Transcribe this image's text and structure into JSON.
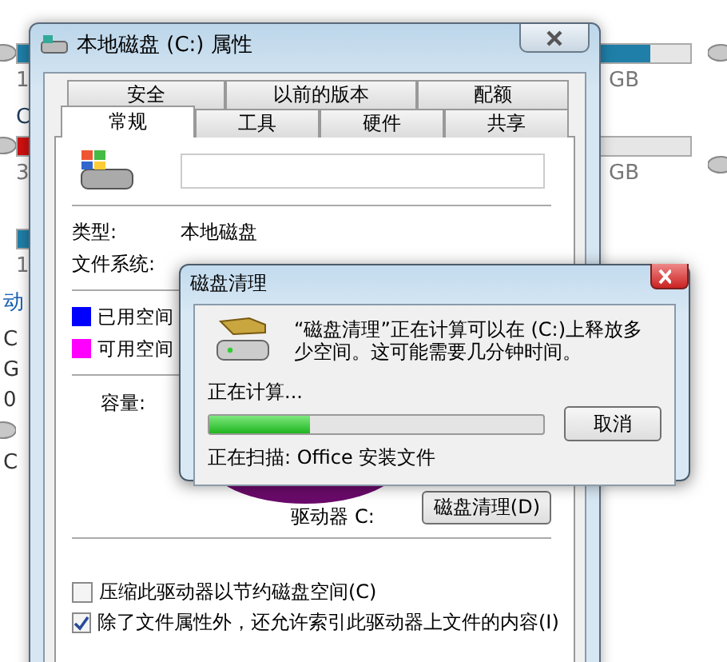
{
  "explorer": {
    "left_tiles": [
      {
        "level": 0.95,
        "color": "#1f7fa8",
        "caption": "1"
      },
      {
        "title": "C",
        "level": 0.95,
        "color": "#d01010",
        "caption": "3"
      },
      {
        "level": 0.6,
        "color": "#1f7fa8",
        "caption": "1"
      }
    ],
    "left_fragments": [
      "动",
      "C",
      "G",
      "0",
      "C"
    ],
    "right_tiles": [
      {
        "level": 0.86,
        "color": "#1f7fa8",
        "caption": "GB"
      },
      {
        "caption": "GB"
      }
    ]
  },
  "properties_dialog": {
    "title": "本地磁盘 (C:) 属性",
    "tabs_back": [
      {
        "label": "安全",
        "selected": false
      },
      {
        "label": "以前的版本",
        "selected": false
      },
      {
        "label": "配额",
        "selected": false
      }
    ],
    "tabs_front": [
      {
        "label": "常规",
        "selected": true
      },
      {
        "label": "工具",
        "selected": false
      },
      {
        "label": "硬件",
        "selected": false
      },
      {
        "label": "共享",
        "selected": false
      }
    ],
    "info": [
      {
        "label": "类型:",
        "value": "本地磁盘"
      },
      {
        "label": "文件系统:"
      }
    ],
    "legend": [
      {
        "label": "已用空间",
        "color": "#0000ff"
      },
      {
        "label": "可用空间",
        "color": "#ff00ff"
      }
    ],
    "capacity_label": "容量:",
    "drive_label": "驱动器 C:",
    "cleanup_button": "磁盘清理(D)",
    "options": [
      {
        "label": "压缩此驱动器以节约磁盘空间(C)",
        "checked": false
      },
      {
        "label": "除了文件属性外，还允许索引此驱动器上文件的内容(I)",
        "checked": true
      }
    ]
  },
  "cleanup_dialog": {
    "title": "磁盘清理",
    "message": "“磁盘清理”正在计算可以在 (C:)上释放多少空间。这可能需要几分钟时间。",
    "status": "正在计算...",
    "progress": {
      "level": 0.3
    },
    "cancel_button": "取消",
    "scanning": "正在扫描: Office 安装文件"
  }
}
